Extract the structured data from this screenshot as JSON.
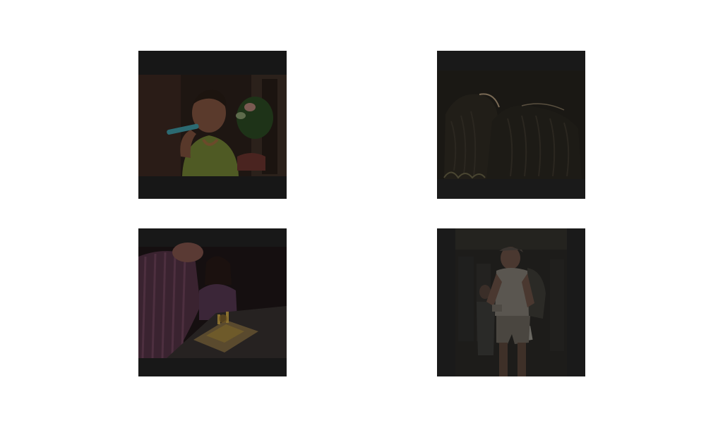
{
  "images": [
    {
      "id": "thumb-1",
      "subject": "toddler-brushing-teeth"
    },
    {
      "id": "thumb-2",
      "subject": "zebras-in-dark"
    },
    {
      "id": "thumb-3",
      "subject": "people-with-birthday-cake"
    },
    {
      "id": "thumb-4",
      "subject": "man-with-backpack-reading"
    }
  ]
}
